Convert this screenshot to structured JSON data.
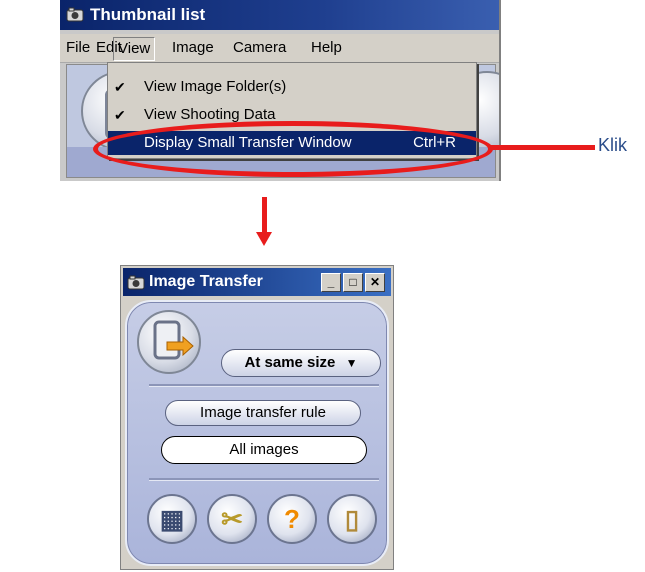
{
  "main_window": {
    "title": "Thumbnail list",
    "menu": [
      "File",
      "Edit",
      "View",
      "Image",
      "Camera",
      "Help"
    ],
    "active_menu": "View",
    "dropdown": [
      {
        "label": "View Image Folder(s)",
        "checked": true,
        "shortcut": ""
      },
      {
        "label": "View Shooting Data",
        "checked": true,
        "shortcut": ""
      },
      {
        "label": "Display Small Transfer Window",
        "checked": false,
        "shortcut": "Ctrl+R",
        "highlighted": true
      }
    ]
  },
  "annotation": {
    "label": "Klik",
    "color": "#e81c1c"
  },
  "transfer_window": {
    "title": "Image Transfer",
    "size_button": "At same size",
    "rule_button": "Image transfer rule",
    "rule_value": "All images",
    "icons": [
      "folder-icon",
      "tools-icon",
      "help-icon",
      "exit-icon"
    ]
  }
}
